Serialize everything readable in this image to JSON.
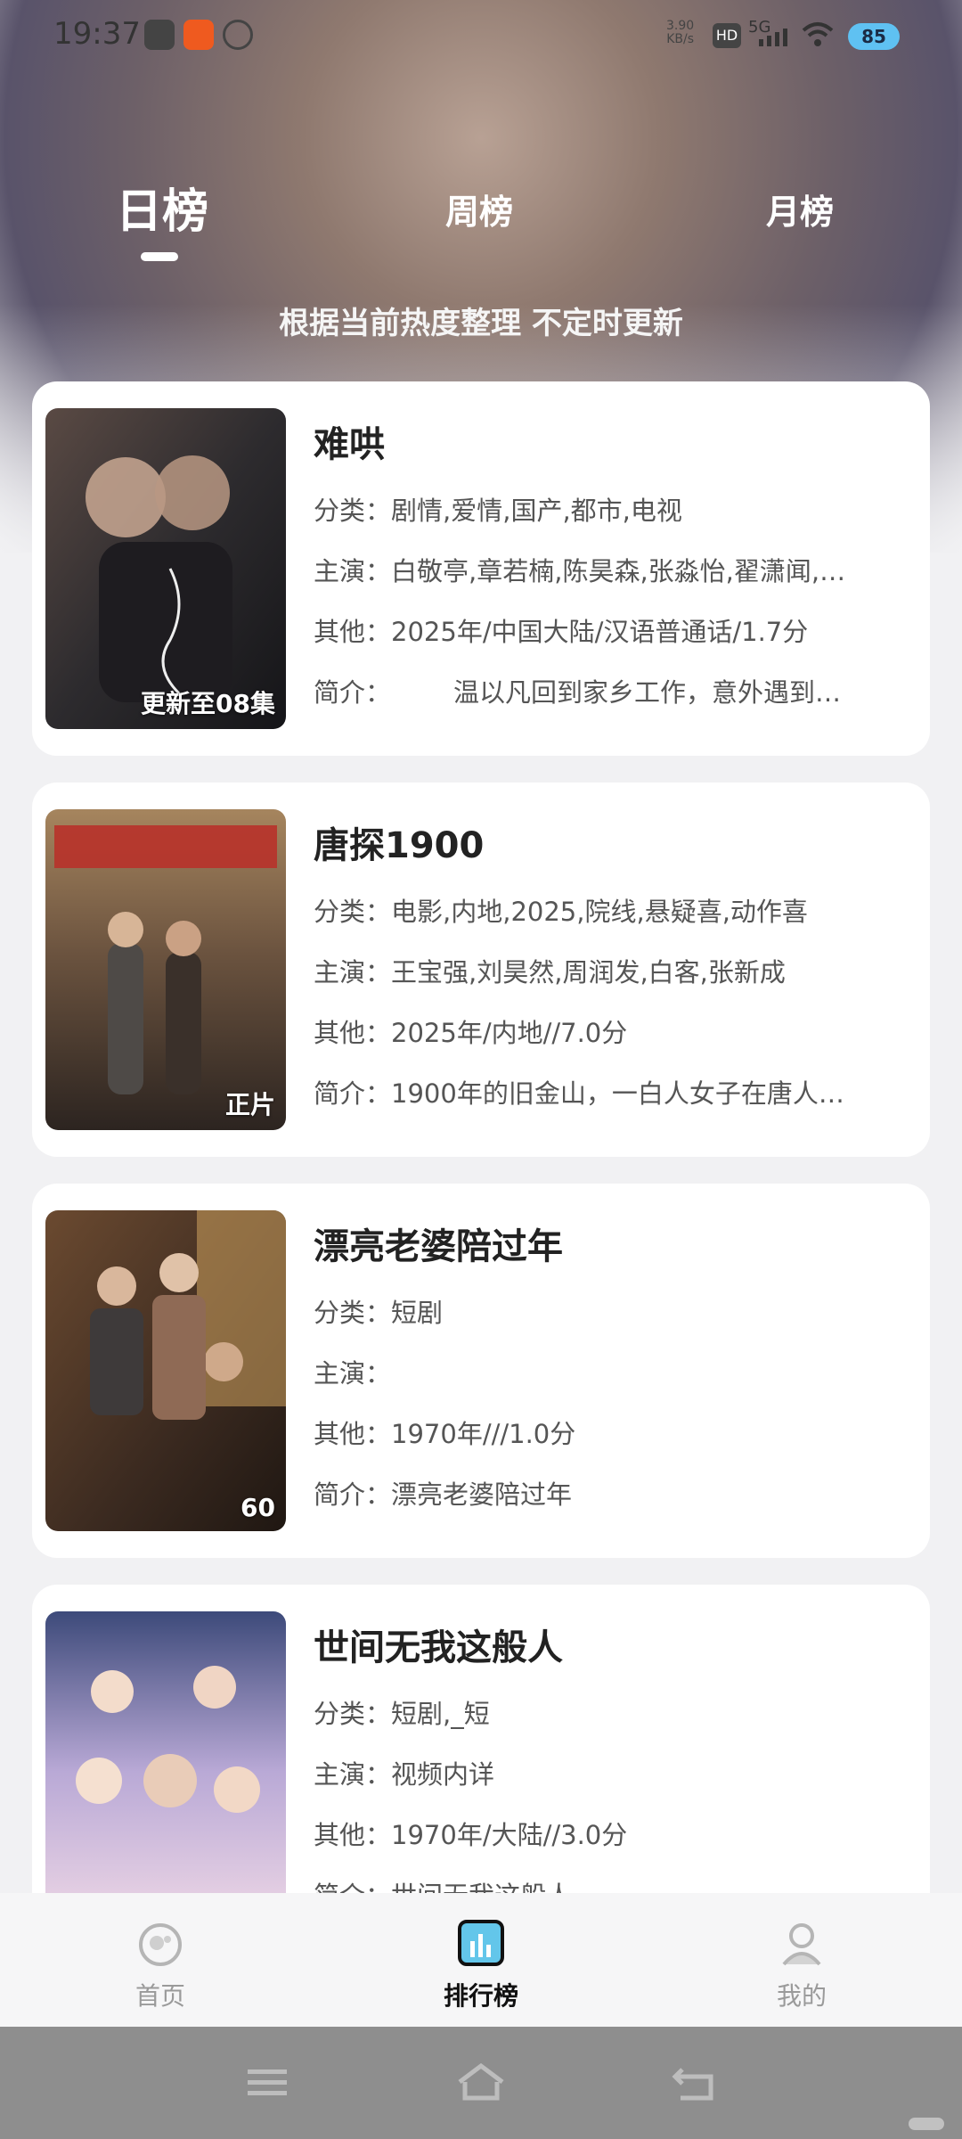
{
  "status_bar": {
    "time": "19:37",
    "net_speed_value": "3.90",
    "net_speed_unit": "KB/s",
    "hd_label": "HD",
    "network": "5G",
    "battery": "85"
  },
  "tabs": {
    "daily": "日榜",
    "weekly": "周榜",
    "monthly": "月榜",
    "active": "daily"
  },
  "subtitle": "根据当前热度整理 不定时更新",
  "labels": {
    "category": "分类：",
    "cast": "主演：",
    "other": "其他：",
    "intro": "简介："
  },
  "items": [
    {
      "title": "难哄",
      "badge": "更新至08集",
      "category": "剧情,爱情,国产,都市,电视",
      "cast": "白敬亭,章若楠,陈昊森,张淼怡,翟潇闻,…",
      "other": "2025年/中国大陆/汉语普通话/1.7分",
      "intro": "温以凡回到家乡工作，意外遇到…",
      "poster_colors": [
        "#2d2b2e",
        "#7b6457",
        "#c9b4a4"
      ]
    },
    {
      "title": "唐探1900",
      "badge": "正片",
      "category": "电影,内地,2025,院线,悬疑喜,动作喜",
      "cast": "王宝强,刘昊然,周润发,白客,张新成",
      "other": "2025年/内地//7.0分",
      "intro": "1900年的旧金山，一白人女子在唐人…",
      "poster_colors": [
        "#5a4236",
        "#8a6b4d",
        "#c53a2a"
      ]
    },
    {
      "title": "漂亮老婆陪过年",
      "badge": "60",
      "category": "短剧",
      "cast": "",
      "other": "1970年///1.0分",
      "intro": "漂亮老婆陪过年",
      "poster_colors": [
        "#3b2a20",
        "#6b4a30",
        "#d9a441"
      ]
    },
    {
      "title": "世间无我这般人",
      "badge": "",
      "category": "短剧,_短",
      "cast": "视频内详",
      "other": "1970年/大陆//3.0分",
      "intro": "世间无我这般人",
      "poster_colors": [
        "#3d4a7a",
        "#b9a9d6",
        "#f0d9e6"
      ]
    }
  ],
  "bottom_nav": {
    "home": "首页",
    "ranking": "排行榜",
    "mine": "我的",
    "active": "ranking"
  },
  "icons": {
    "home": "tv-icon",
    "ranking": "chart-icon",
    "mine": "user-icon"
  }
}
